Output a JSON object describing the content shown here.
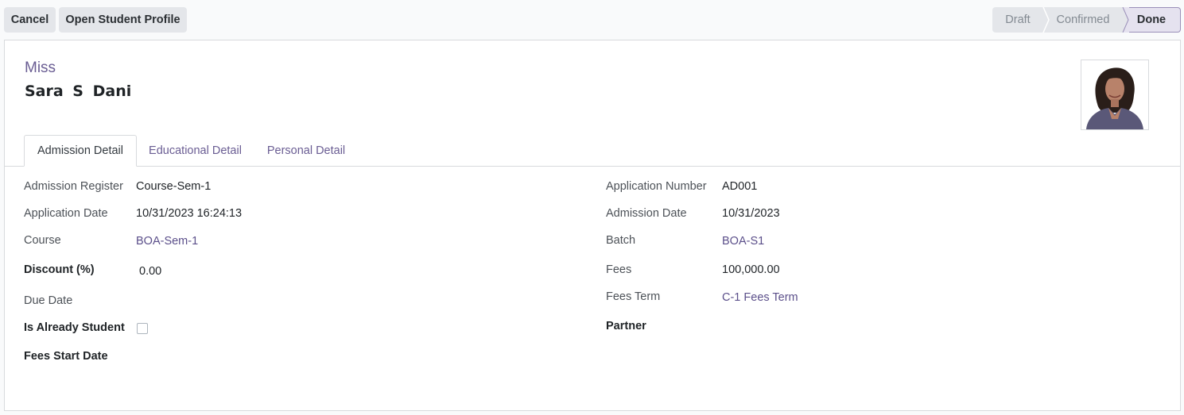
{
  "toolbar": {
    "cancel_label": "Cancel",
    "open_profile_label": "Open Student Profile"
  },
  "status": {
    "stages": [
      "Draft",
      "Confirmed",
      "Done"
    ],
    "current": "Done"
  },
  "record": {
    "title_prefix": "Miss",
    "name": "Sara S Dani",
    "avatar_icon": "student-photo"
  },
  "tabs": [
    {
      "label": "Admission Detail",
      "active": true
    },
    {
      "label": "Educational Detail",
      "active": false
    },
    {
      "label": "Personal Detail",
      "active": false
    }
  ],
  "fields_left": {
    "admission_register": {
      "label": "Admission Register",
      "value": "Course-Sem-1"
    },
    "application_date": {
      "label": "Application Date",
      "value": "10/31/2023 16:24:13"
    },
    "course": {
      "label": "Course",
      "value": "BOA-Sem-1"
    },
    "discount": {
      "label": "Discount (%)",
      "value": "0.00"
    },
    "due_date": {
      "label": "Due Date",
      "value": ""
    },
    "is_already_student": {
      "label": "Is Already Student",
      "checked": false
    },
    "fees_start_date": {
      "label": "Fees Start Date",
      "value": ""
    }
  },
  "fields_right": {
    "application_number": {
      "label": "Application Number",
      "value": "AD001"
    },
    "admission_date": {
      "label": "Admission Date",
      "value": "10/31/2023"
    },
    "batch": {
      "label": "Batch",
      "value": "BOA-S1"
    },
    "fees": {
      "label": "Fees",
      "value": "100,000.00"
    },
    "fees_term": {
      "label": "Fees Term",
      "value": "C-1 Fees Term"
    },
    "partner": {
      "label": "Partner",
      "value": ""
    }
  },
  "colors": {
    "accent": "#6a5d93",
    "link": "#5b4f8a",
    "button_bg": "#e4e6ea"
  }
}
